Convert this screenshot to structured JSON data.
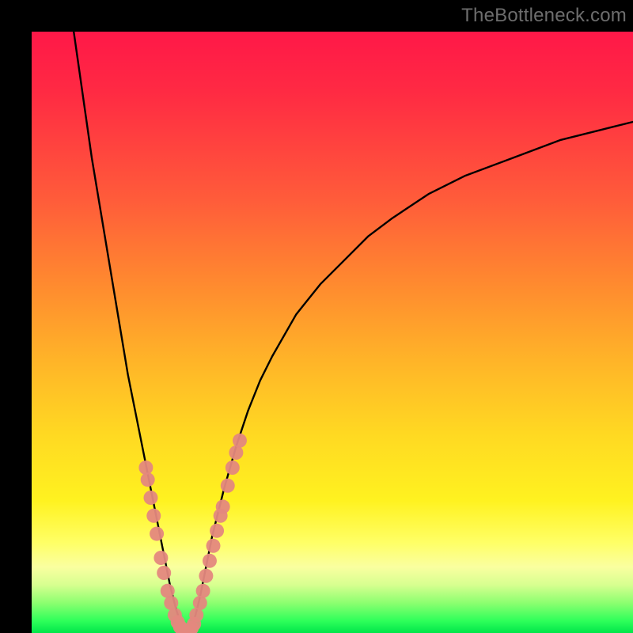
{
  "watermark": "TheBottleneck.com",
  "chart_data": {
    "type": "line",
    "title": "",
    "xlabel": "",
    "ylabel": "",
    "xlim": [
      0,
      100
    ],
    "ylim": [
      0,
      100
    ],
    "background_gradient": {
      "top": "#ff1848",
      "bottom": "#00e64a",
      "meaning": "mismatch severity (red high, green low)"
    },
    "series": [
      {
        "name": "bottleneck-curve",
        "stroke": "#000000",
        "x": [
          7,
          8,
          9,
          10,
          11,
          12,
          13,
          14,
          15,
          16,
          17,
          18,
          19,
          20,
          21,
          22,
          23,
          24,
          25,
          26,
          27,
          28,
          29,
          30,
          32,
          34,
          36,
          38,
          40,
          44,
          48,
          52,
          56,
          60,
          66,
          72,
          80,
          88,
          96,
          100
        ],
        "y": [
          100,
          93,
          86,
          79,
          73,
          67,
          61,
          55,
          49,
          43,
          38,
          33,
          28,
          23,
          18,
          13,
          8,
          4,
          1,
          0,
          2,
          6,
          11,
          16,
          24,
          31,
          37,
          42,
          46,
          53,
          58,
          62,
          66,
          69,
          73,
          76,
          79,
          82,
          84,
          85
        ]
      }
    ],
    "highlight_points": {
      "name": "sampled-markers",
      "fill": "#e4887e",
      "x": [
        19.0,
        19.3,
        19.8,
        20.3,
        20.8,
        21.5,
        22.0,
        22.6,
        23.2,
        23.8,
        24.3,
        24.7,
        25.0,
        25.4,
        25.8,
        26.2,
        26.6,
        27.0,
        27.4,
        28.0,
        28.5,
        29.0,
        29.6,
        30.2,
        30.8,
        31.4,
        31.8,
        32.6,
        33.4,
        34.0,
        34.6
      ],
      "y": [
        27.5,
        25.5,
        22.5,
        19.5,
        16.5,
        12.5,
        10.0,
        7.0,
        5.0,
        3.0,
        1.8,
        1.0,
        0.6,
        0.4,
        0.3,
        0.4,
        0.8,
        1.5,
        3.0,
        5.0,
        7.0,
        9.5,
        12.0,
        14.5,
        17.0,
        19.5,
        21.0,
        24.5,
        27.5,
        30.0,
        32.0
      ]
    }
  }
}
